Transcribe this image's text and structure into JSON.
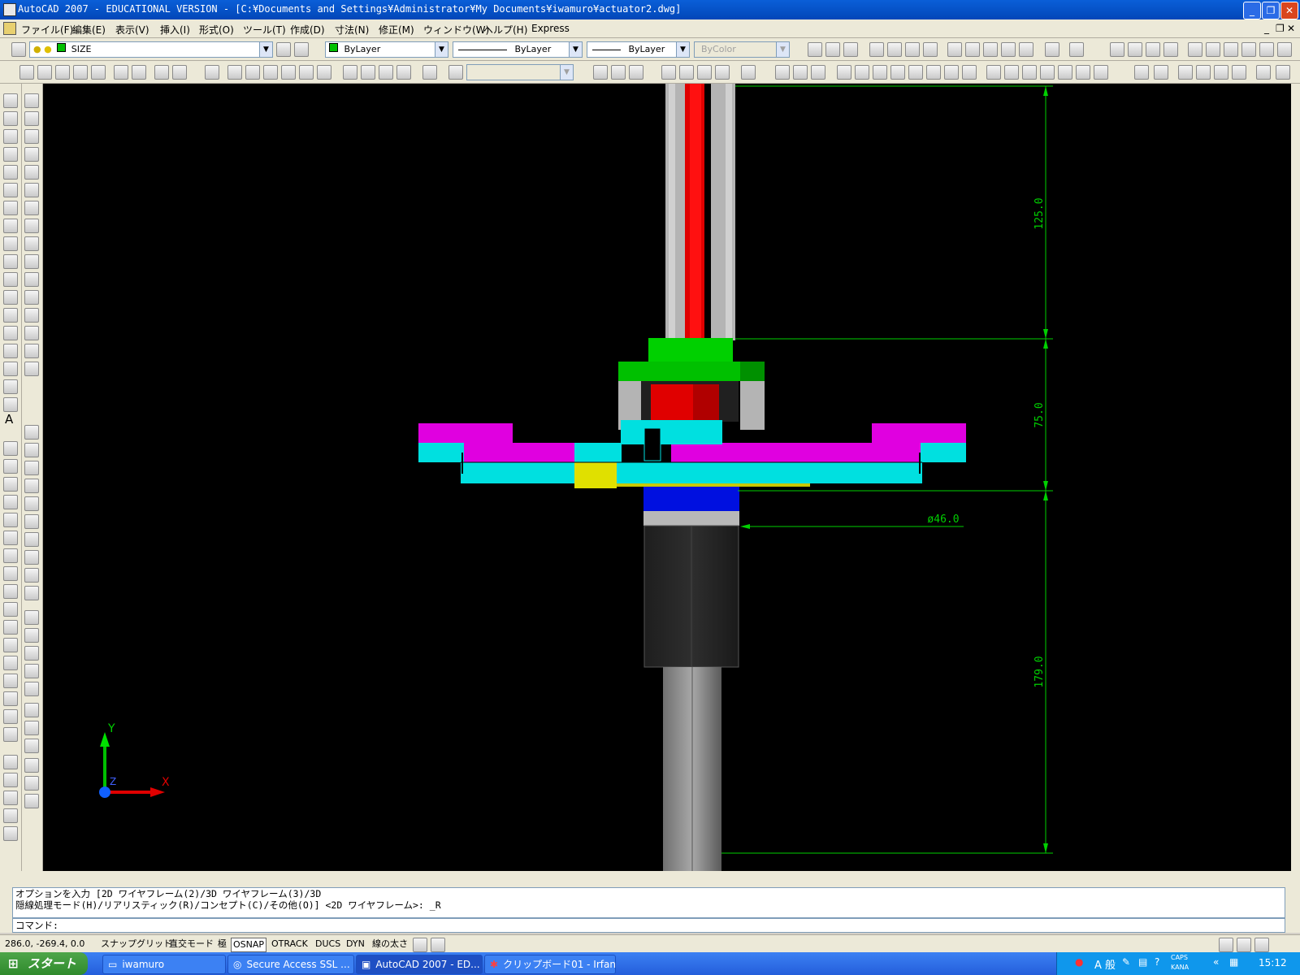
{
  "window": {
    "title": "AutoCAD 2007 - EDUCATIONAL VERSION - [C:¥Documents and Settings¥Administrator¥My Documents¥iwamuro¥actuator2.dwg]"
  },
  "menu": [
    "ファイル(F)",
    "編集(E)",
    "表示(V)",
    "挿入(I)",
    "形式(O)",
    "ツール(T)",
    "作成(D)",
    "寸法(N)",
    "修正(M)",
    "ウィンドウ(W)",
    "ヘルプ(H)",
    "Express"
  ],
  "toolbar": {
    "layer_name": "SIZE",
    "color": "ByLayer",
    "linetype": "ByLayer",
    "lineweight": "ByLayer",
    "plotstyle": "ByColor"
  },
  "drawing": {
    "dim_top": "125.0",
    "dim_mid": "75.0",
    "dim_bottom": "179.0",
    "dim_dia": "ø46.0",
    "ucs_y": "Y",
    "ucs_x": "X",
    "ucs_z": "Z",
    "colors": {
      "red": "#e00000",
      "green": "#00d000",
      "magenta": "#e000e0",
      "cyan": "#00e0e0",
      "yellow": "#e0e000",
      "blue": "#0010e0",
      "gray": "#b0b0b0",
      "dim": "#00d000"
    }
  },
  "command": {
    "history_line1": "オプションを入力 [2D ワイヤフレーム(2)/3D ワイヤフレーム(3)/3D",
    "history_line2": "隠線処理モード(H)/リアリスティック(R)/コンセプト(C)/その他(O)] <2D ワイヤフレーム>: _R",
    "prompt": "コマンド:"
  },
  "status": {
    "coords": "286.0, -269.4, 0.0",
    "buttons": [
      {
        "label": "スナップ",
        "on": false
      },
      {
        "label": "グリッド",
        "on": false
      },
      {
        "label": "直交モード",
        "on": false
      },
      {
        "label": "極",
        "on": false
      },
      {
        "label": "OSNAP",
        "on": true
      },
      {
        "label": "OTRACK",
        "on": false
      },
      {
        "label": "DUCS",
        "on": false
      },
      {
        "label": "DYN",
        "on": false
      },
      {
        "label": "線の太さ",
        "on": false
      }
    ]
  },
  "taskbar": {
    "start": "スタート",
    "tasks": [
      {
        "label": "iwamuro",
        "active": false
      },
      {
        "label": "Secure Access SSL ...",
        "active": false
      },
      {
        "label": "AutoCAD 2007 - ED...",
        "active": true
      },
      {
        "label": "クリップボード01 - Irfan...",
        "active": false
      }
    ],
    "ime": "A 般",
    "caps": "CAPS",
    "kana": "KANA",
    "clock": "15:12"
  }
}
